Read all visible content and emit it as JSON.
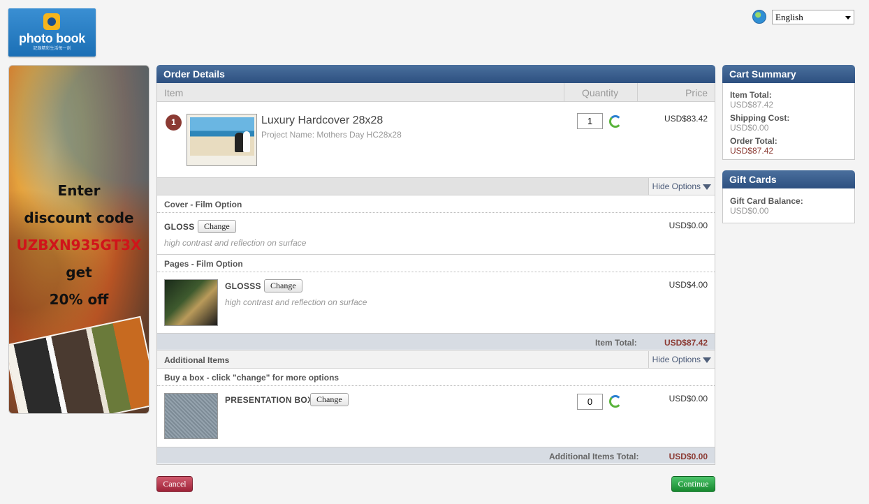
{
  "logo": {
    "text": "photo book",
    "tagline": "記錄精彩生活每一刻"
  },
  "language": {
    "selected": "English"
  },
  "banner": {
    "line1": "Enter",
    "line2": "discount code",
    "code": "UZBXN935GT3X",
    "line3": "get",
    "line4": "20% off"
  },
  "order": {
    "title": "Order Details",
    "columns": {
      "item": "Item",
      "quantity": "Quantity",
      "price": "Price"
    },
    "product": {
      "index": "1",
      "name": "Luxury Hardcover 28x28",
      "project": "Project Name: Mothers Day HC28x28",
      "quantity": "1",
      "price": "USD$83.42"
    },
    "hide_options": "Hide Options",
    "cover": {
      "section": "Cover - Film Option",
      "name": "GLOSS",
      "change": "Change",
      "desc": "high contrast and reflection on surface",
      "price": "USD$0.00"
    },
    "pages": {
      "section": "Pages - Film Option",
      "name": "GLOSSS",
      "change": "Change",
      "desc": "high contrast and reflection on surface",
      "price": "USD$4.00"
    },
    "item_total_label": "Item Total:",
    "item_total": "USD$87.42",
    "additional": {
      "title": "Additional Items",
      "hide_options": "Hide Options",
      "section": "Buy a box - click \"change\" for more options",
      "name": "PRESENTATION BOX",
      "change": "Change",
      "quantity": "0",
      "price": "USD$0.00",
      "total_label": "Additional Items Total:",
      "total": "USD$0.00"
    }
  },
  "buttons": {
    "cancel": "Cancel",
    "continue": "Continue"
  },
  "cart": {
    "title": "Cart Summary",
    "item_total_label": "Item Total:",
    "item_total": "USD$87.42",
    "shipping_label": "Shipping Cost:",
    "shipping": "USD$0.00",
    "order_total_label": "Order Total:",
    "order_total": "USD$87.42"
  },
  "gift": {
    "title": "Gift Cards",
    "balance_label": "Gift Card Balance:",
    "balance": "USD$0.00"
  },
  "colors": {
    "header": "#2c4f7f",
    "accent_red": "#8b3a33",
    "cancel": "#9e2238",
    "continue": "#17882f"
  }
}
